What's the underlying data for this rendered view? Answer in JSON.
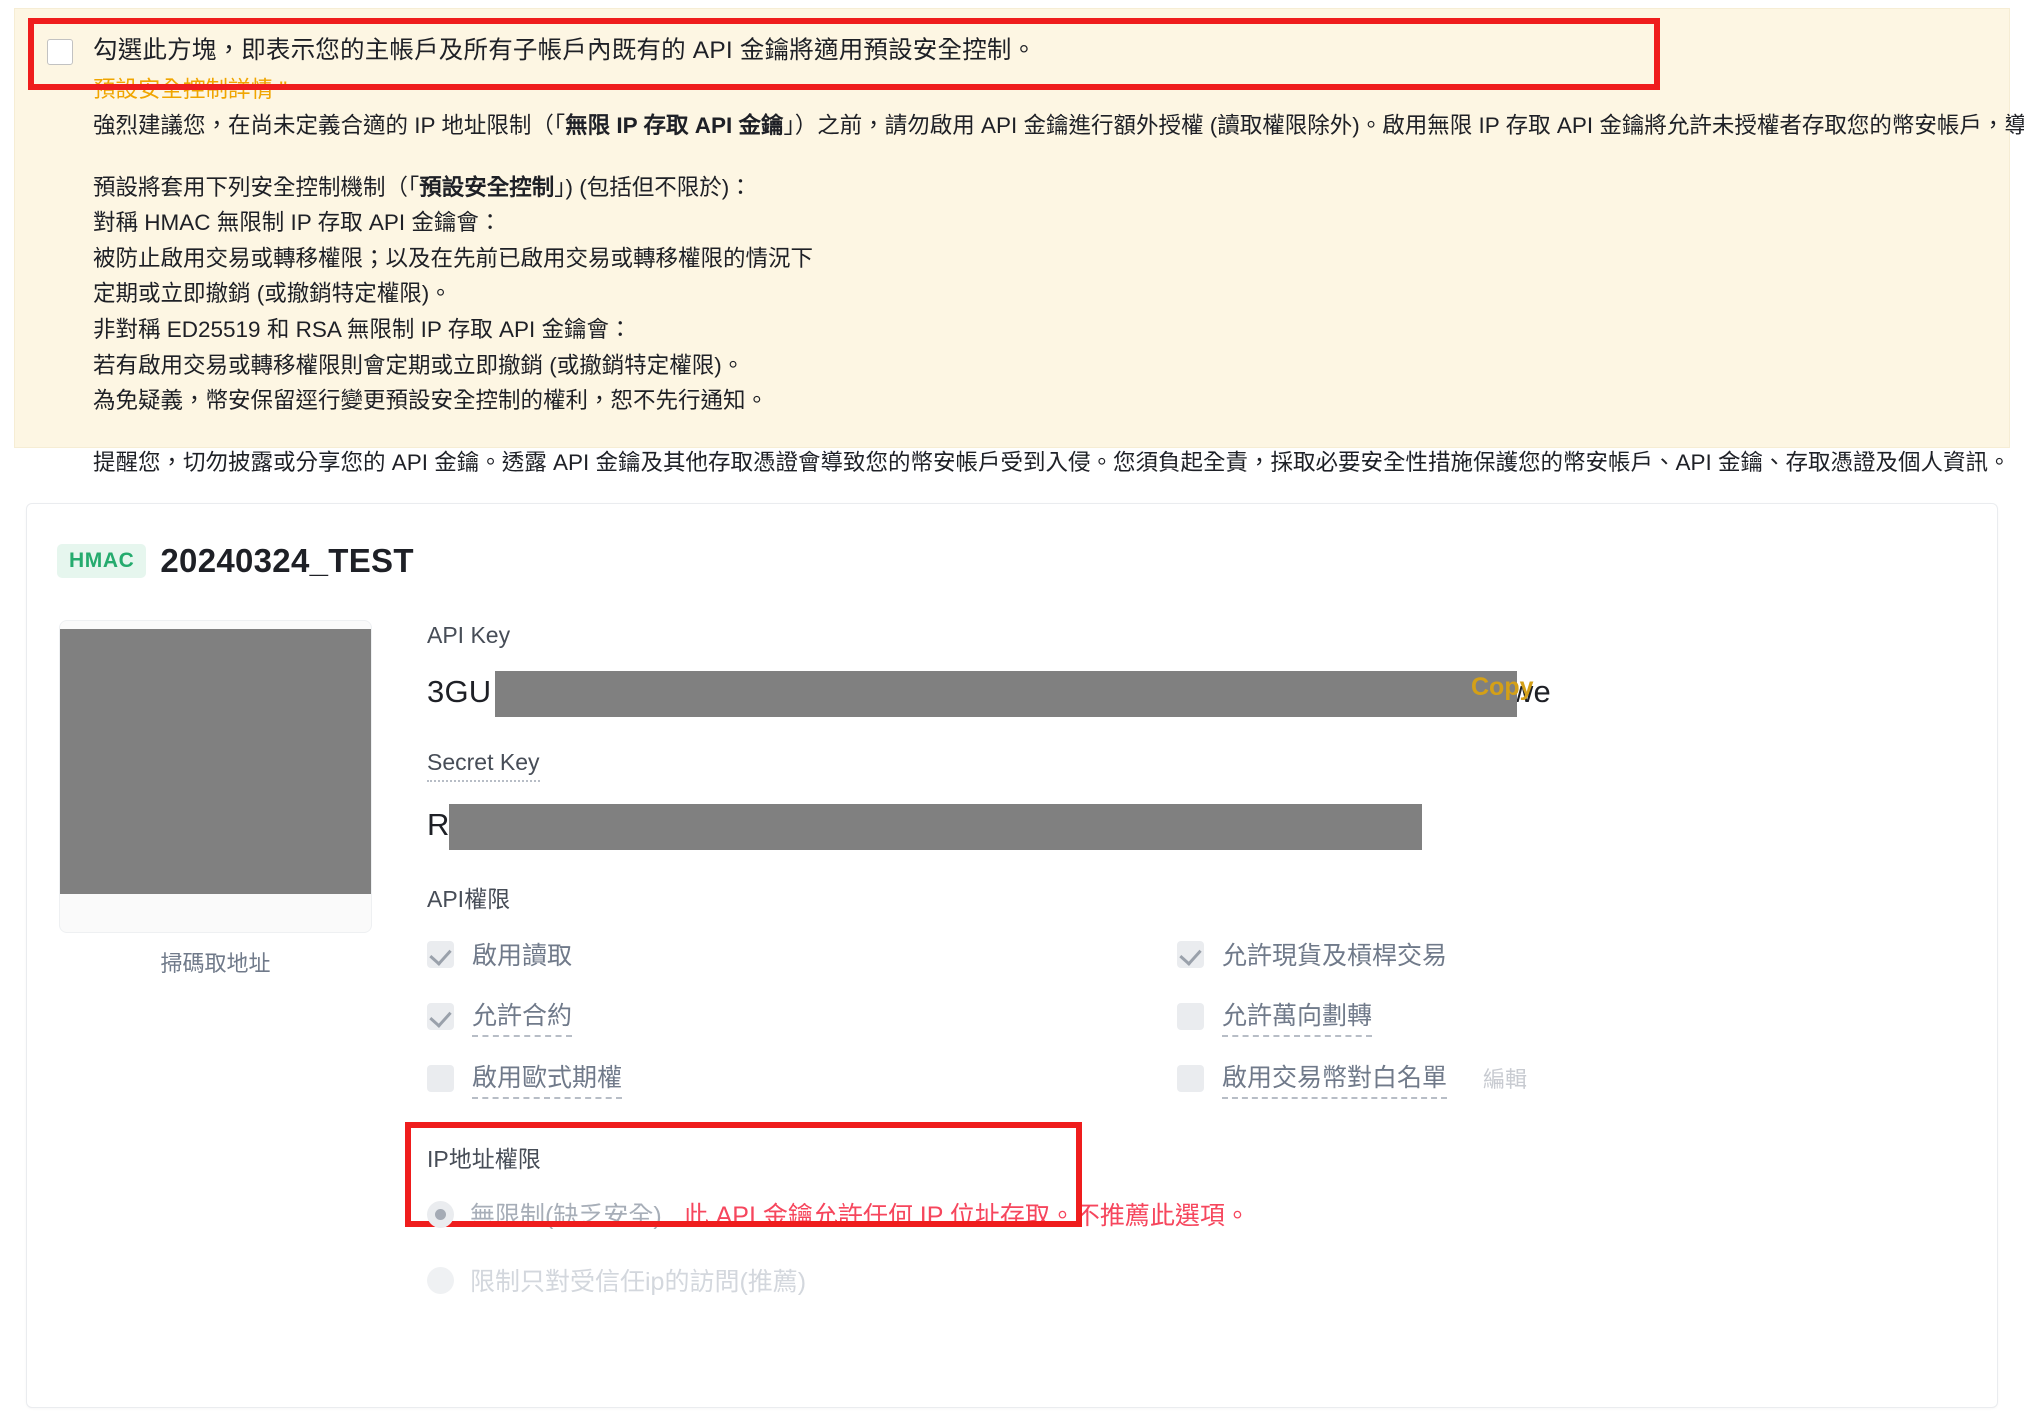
{
  "warning": {
    "checkbox_label": "勾選此方塊，即表示您的主帳戶及所有子帳戶內既有的 API 金鑰將適用預設安全控制。",
    "details_link": "預設安全控制詳情 \"",
    "paragraph_1": "強烈建議您，在尚未定義合適的 IP 地址限制（「無限 IP 存取 API 金鑰」）之前，請勿啟用 API 金鑰進行額外授權 (讀取權限除外)。啟用無限 IP 存取 API 金鑰將允許未授權者存取您的幣安帳戶，導致風險增加。",
    "line_2": "預設將套用下列安全控制機制（「預設安全控制」) (包括但不限於)：",
    "line_3": "對稱 HMAC 無限制 IP 存取 API 金鑰會：",
    "line_4": "被防止啟用交易或轉移權限；以及在先前已啟用交易或轉移權限的情況下",
    "line_5": "定期或立即撤銷 (或撤銷特定權限)。",
    "line_6": "非對稱 ED25519 和 RSA 無限制 IP 存取 API 金鑰會：",
    "line_7": "若有啟用交易或轉移權限則會定期或立即撤銷 (或撤銷特定權限)。",
    "line_8": "為免疑義，幣安保留逕行變更預設安全控制的權利，恕不先行通知。",
    "paragraph_last": "提醒您，切勿披露或分享您的 API 金鑰。透露 API 金鑰及其他存取憑證會導致您的幣安帳戶受到入侵。您須負起全責，採取必要安全性措施保護您的幣安帳戶、API 金鑰、存取憑證及個人資訊。",
    "accent_color": "#f0a500",
    "bg_color": "#fdf6e3",
    "highlight_color": "#ef1d1d"
  },
  "card": {
    "badge": "HMAC",
    "title": "20240324_TEST",
    "badge_color": "#25ab6e",
    "qr": {
      "caption": "掃碼取地址"
    },
    "api_key": {
      "label": "API Key",
      "value_prefix": "3GU",
      "value_suffix": "uwe",
      "copy_label": "Copy",
      "copy_color": "#d4a017"
    },
    "secret_key": {
      "label": "Secret Key",
      "value_prefix": "R"
    },
    "permissions": {
      "title": "API權限",
      "items": [
        {
          "label": "啟用讀取",
          "checked": true,
          "dotted": false
        },
        {
          "label": "允許現貨及槓桿交易",
          "checked": true,
          "dotted": false
        },
        {
          "label": "允許合約",
          "checked": true,
          "dotted": true
        },
        {
          "label": "允許萬向劃轉",
          "checked": false,
          "dotted": true
        },
        {
          "label": "啟用歐式期權",
          "checked": false,
          "dotted": true
        },
        {
          "label": "啟用交易幣對白名單",
          "checked": false,
          "dotted": true,
          "action": "編輯"
        }
      ]
    },
    "ip_access": {
      "title": "IP地址權限",
      "option_unrestricted": "無限制(缺乏安全)",
      "option_unrestricted_warning": "此 API 金鑰允許任何 IP 位址存取。不推薦此選項。",
      "option_restricted": "限制只對受信任ip的訪問(推薦)",
      "warning_color": "#f6465d"
    }
  }
}
